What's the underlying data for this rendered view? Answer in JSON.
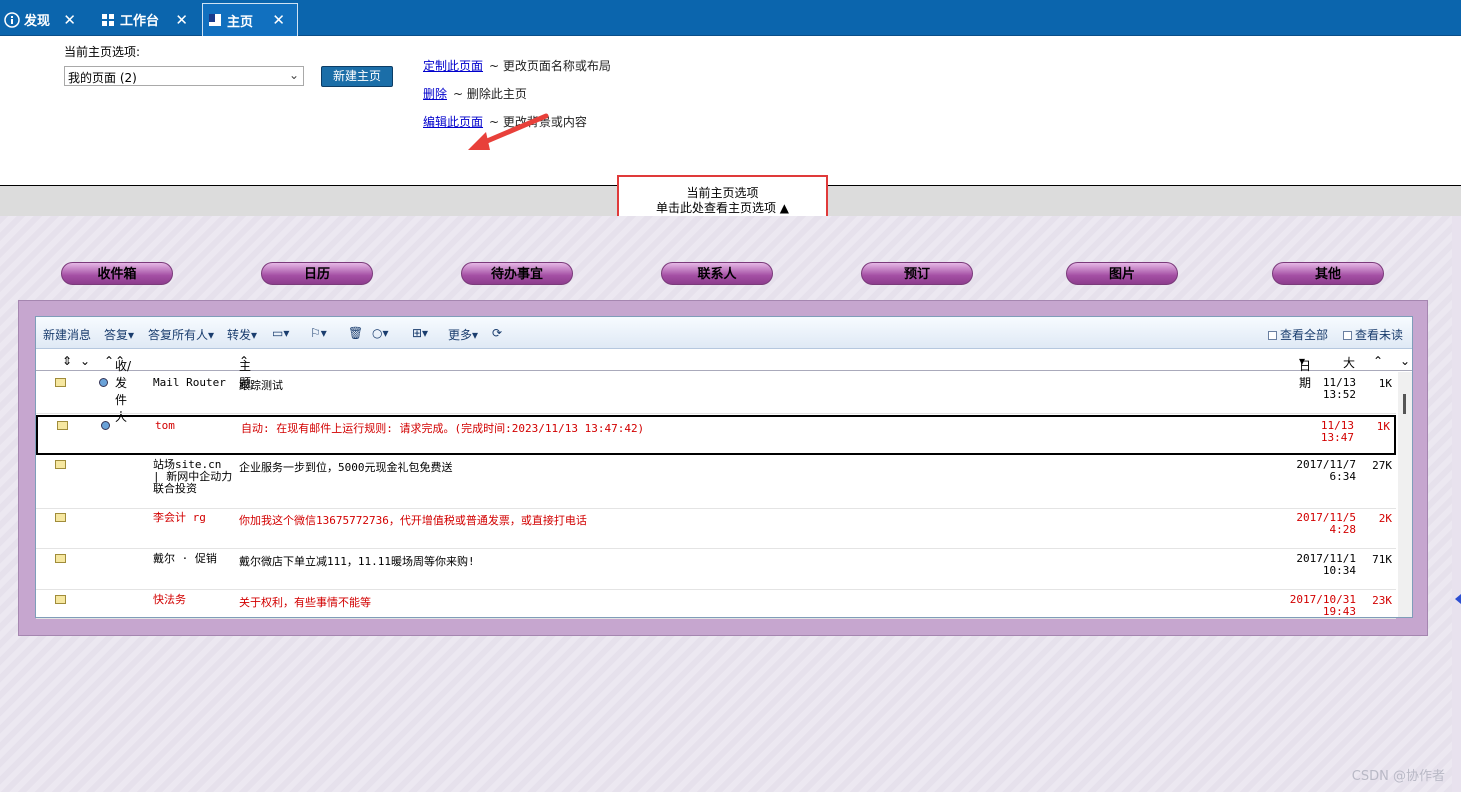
{
  "tabs": [
    {
      "label": "发现",
      "icon": "info-icon"
    },
    {
      "label": "工作台",
      "icon": "grid-icon"
    },
    {
      "label": "主页",
      "icon": "home-page-icon"
    }
  ],
  "home_options": {
    "label": "当前主页选项:",
    "selected": "我的页面 (2)",
    "new_button": "新建主页",
    "links": [
      {
        "link": "定制此页面",
        "desc": "~ 更改页面名称或布局"
      },
      {
        "link": "删除",
        "desc": "~ 删除此主页"
      },
      {
        "link": "编辑此页面",
        "desc": "~ 更改背景或内容"
      }
    ]
  },
  "options_toggle": {
    "title": "当前主页选项",
    "sub": "单击此处查看主页选项"
  },
  "nav_buttons": [
    "收件箱",
    "日历",
    "待办事宜",
    "联系人",
    "预订",
    "图片",
    "其他"
  ],
  "toolbar": {
    "new_msg": "新建消息",
    "reply": "答复",
    "reply_all": "答复所有人",
    "forward": "转发",
    "more": "更多",
    "view_all": "查看全部",
    "view_unread": "查看未读"
  },
  "columns": {
    "from": "收/发件人",
    "subject": "主题",
    "date": "日期",
    "size": "大"
  },
  "messages": [
    {
      "from": "Mail Router",
      "subject": "跟踪测试",
      "date": "11/13\n13:52",
      "size": "1K",
      "red": false,
      "dot": true,
      "selected": false
    },
    {
      "from": "tom",
      "subject": "自动: 在现有邮件上运行规则: 请求完成。(完成时间:2023/11/13 13:47:42)",
      "date": "11/13\n13:47",
      "size": "1K",
      "red": true,
      "dot": true,
      "selected": true
    },
    {
      "from": "站场site.cn | 新网中企动力 联合投资",
      "subject": "企业服务一步到位，5000元现金礼包免费送",
      "date": "2017/11/7\n6:34",
      "size": "27K",
      "red": false,
      "dot": false,
      "selected": false
    },
    {
      "from": "李会计 rg",
      "subject": "你加我这个微信13675772736，代开增值税或普通发票，或直接打电话",
      "date": "2017/11/5\n4:28",
      "size": "2K",
      "red": true,
      "dot": false,
      "selected": false
    },
    {
      "from": "戴尔 · 促销",
      "subject": "戴尔微店下单立减111，11.11暖场周等你来购!",
      "date": "2017/11/1\n10:34",
      "size": "71K",
      "red": false,
      "dot": false,
      "selected": false
    },
    {
      "from": "快法务",
      "subject": "关于权利，有些事情不能等",
      "date": "2017/10/31\n19:43",
      "size": "23K",
      "red": true,
      "dot": false,
      "selected": false
    }
  ],
  "watermark": "CSDN @协作者"
}
